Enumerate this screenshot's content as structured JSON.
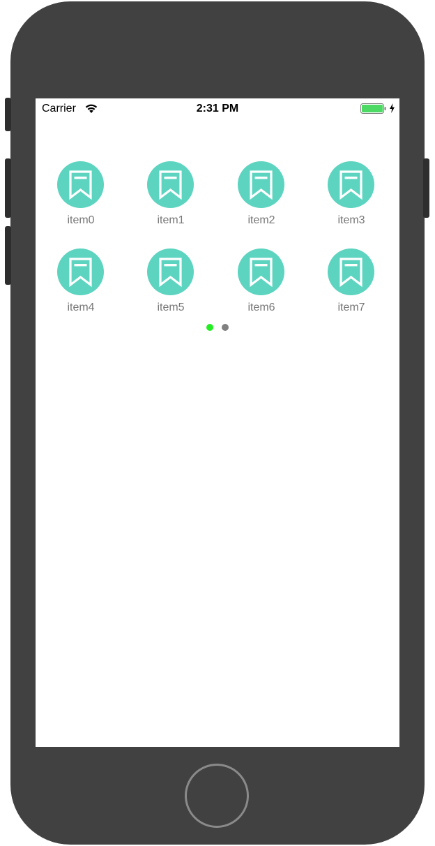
{
  "status_bar": {
    "carrier": "Carrier",
    "time": "2:31 PM",
    "wifi_icon": "wifi-icon",
    "battery_icon": "battery-full-icon",
    "charging_icon": "charging-bolt-icon",
    "battery_color": "#4cd964"
  },
  "grid": {
    "icon_name": "bookmark-icon",
    "icon_color": "#5cd4c0",
    "items": [
      {
        "label": "item0"
      },
      {
        "label": "item1"
      },
      {
        "label": "item2"
      },
      {
        "label": "item3"
      },
      {
        "label": "item4"
      },
      {
        "label": "item5"
      },
      {
        "label": "item6"
      },
      {
        "label": "item7"
      }
    ]
  },
  "pager": {
    "page_count": 2,
    "current_page": 1,
    "active_color": "#22ee22",
    "inactive_color": "#808080"
  },
  "device": {
    "frame_color": "#414141",
    "home_button_icon": "home-button-icon"
  }
}
